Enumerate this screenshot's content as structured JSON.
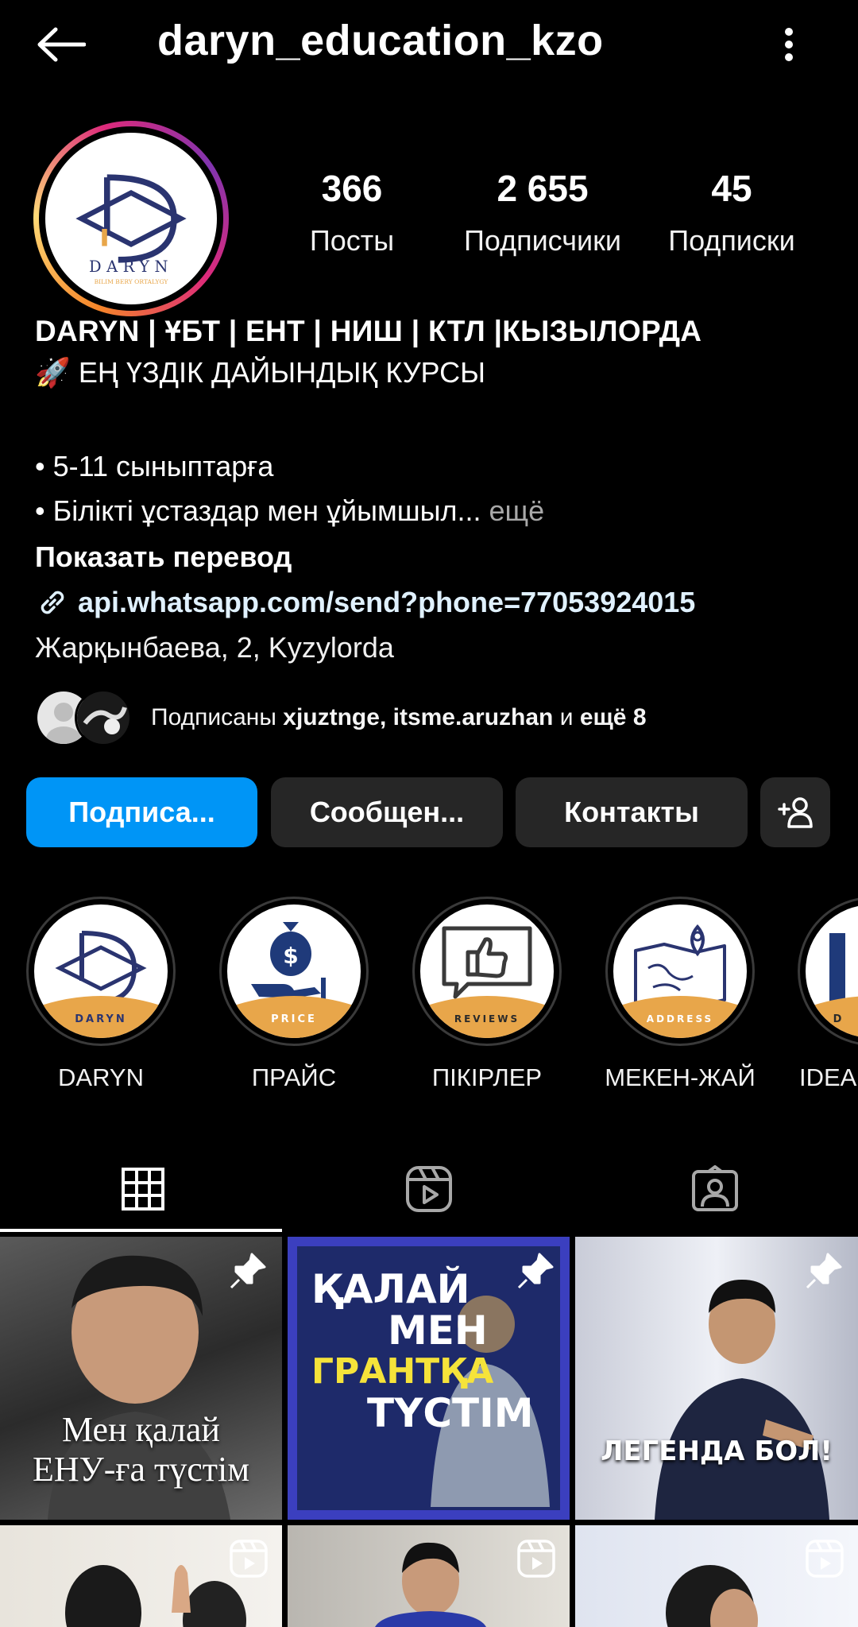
{
  "header": {
    "username": "daryn_education_kzo"
  },
  "profile": {
    "avatar_text": "DARYN",
    "avatar_subtext": "BILIM BERY ORTALYGY",
    "stats": [
      {
        "value": "366",
        "label": "Посты"
      },
      {
        "value": "2 655",
        "label": "Подписчики"
      },
      {
        "value": "45",
        "label": "Подписки"
      }
    ],
    "name": "DARYN | ҰБТ | ЕНТ | НИШ | КТЛ |КЫЗЫЛОРДА",
    "bio_line1": "🚀 ЕҢ ҮЗДІК ДАЙЫНДЫҚ КУРСЫ",
    "bio_line2": "•  5-11 сыныптарға",
    "bio_line3": "• Білікті ұстаздар мен ұйымшыл...",
    "bio_more": "ещё",
    "show_translation": "Показать перевод",
    "link": "api.whatsapp.com/send?phone=77053924015",
    "address": "Жарқынбаева, 2, Kyzylorda"
  },
  "followed_by": {
    "prefix": "Подписаны",
    "user1": "xjuztnge",
    "user2": "itsme.aruzhan",
    "conj": "и",
    "more": "ещё 8"
  },
  "buttons": {
    "follow": "Подписа...",
    "message": "Сообщен...",
    "contacts": "Контакты"
  },
  "highlights": [
    {
      "label": "DARYN",
      "badge": "DARYN"
    },
    {
      "label": "ПРАЙС",
      "badge": "PRICE"
    },
    {
      "label": "ПІКІРЛЕР",
      "badge": "REVIEWS"
    },
    {
      "label": "МЕКЕН-ЖАЙ",
      "badge": "ADDRESS"
    },
    {
      "label": "IDEAL",
      "badge": "D"
    }
  ],
  "tabs": [
    "grid-icon",
    "reels-icon",
    "tagged-icon"
  ],
  "posts": [
    {
      "caption_line1": "Мен қалай",
      "caption_line2": "ЕНУ-ға түстім"
    },
    {
      "line1": "ҚАЛАЙ",
      "line2": "МЕН",
      "line3": "ГРАНТҚА",
      "line4": "ТҮСТІМ"
    },
    {
      "caption": "ЛЕГЕНДА БОЛ!"
    }
  ],
  "colors": {
    "accent": "#0095f6",
    "button_bg": "#262626",
    "link": "#e0f1ff",
    "muted": "#a8a8a8",
    "badge_orange": "#e8a64a",
    "logo_navy": "#2a3470"
  }
}
